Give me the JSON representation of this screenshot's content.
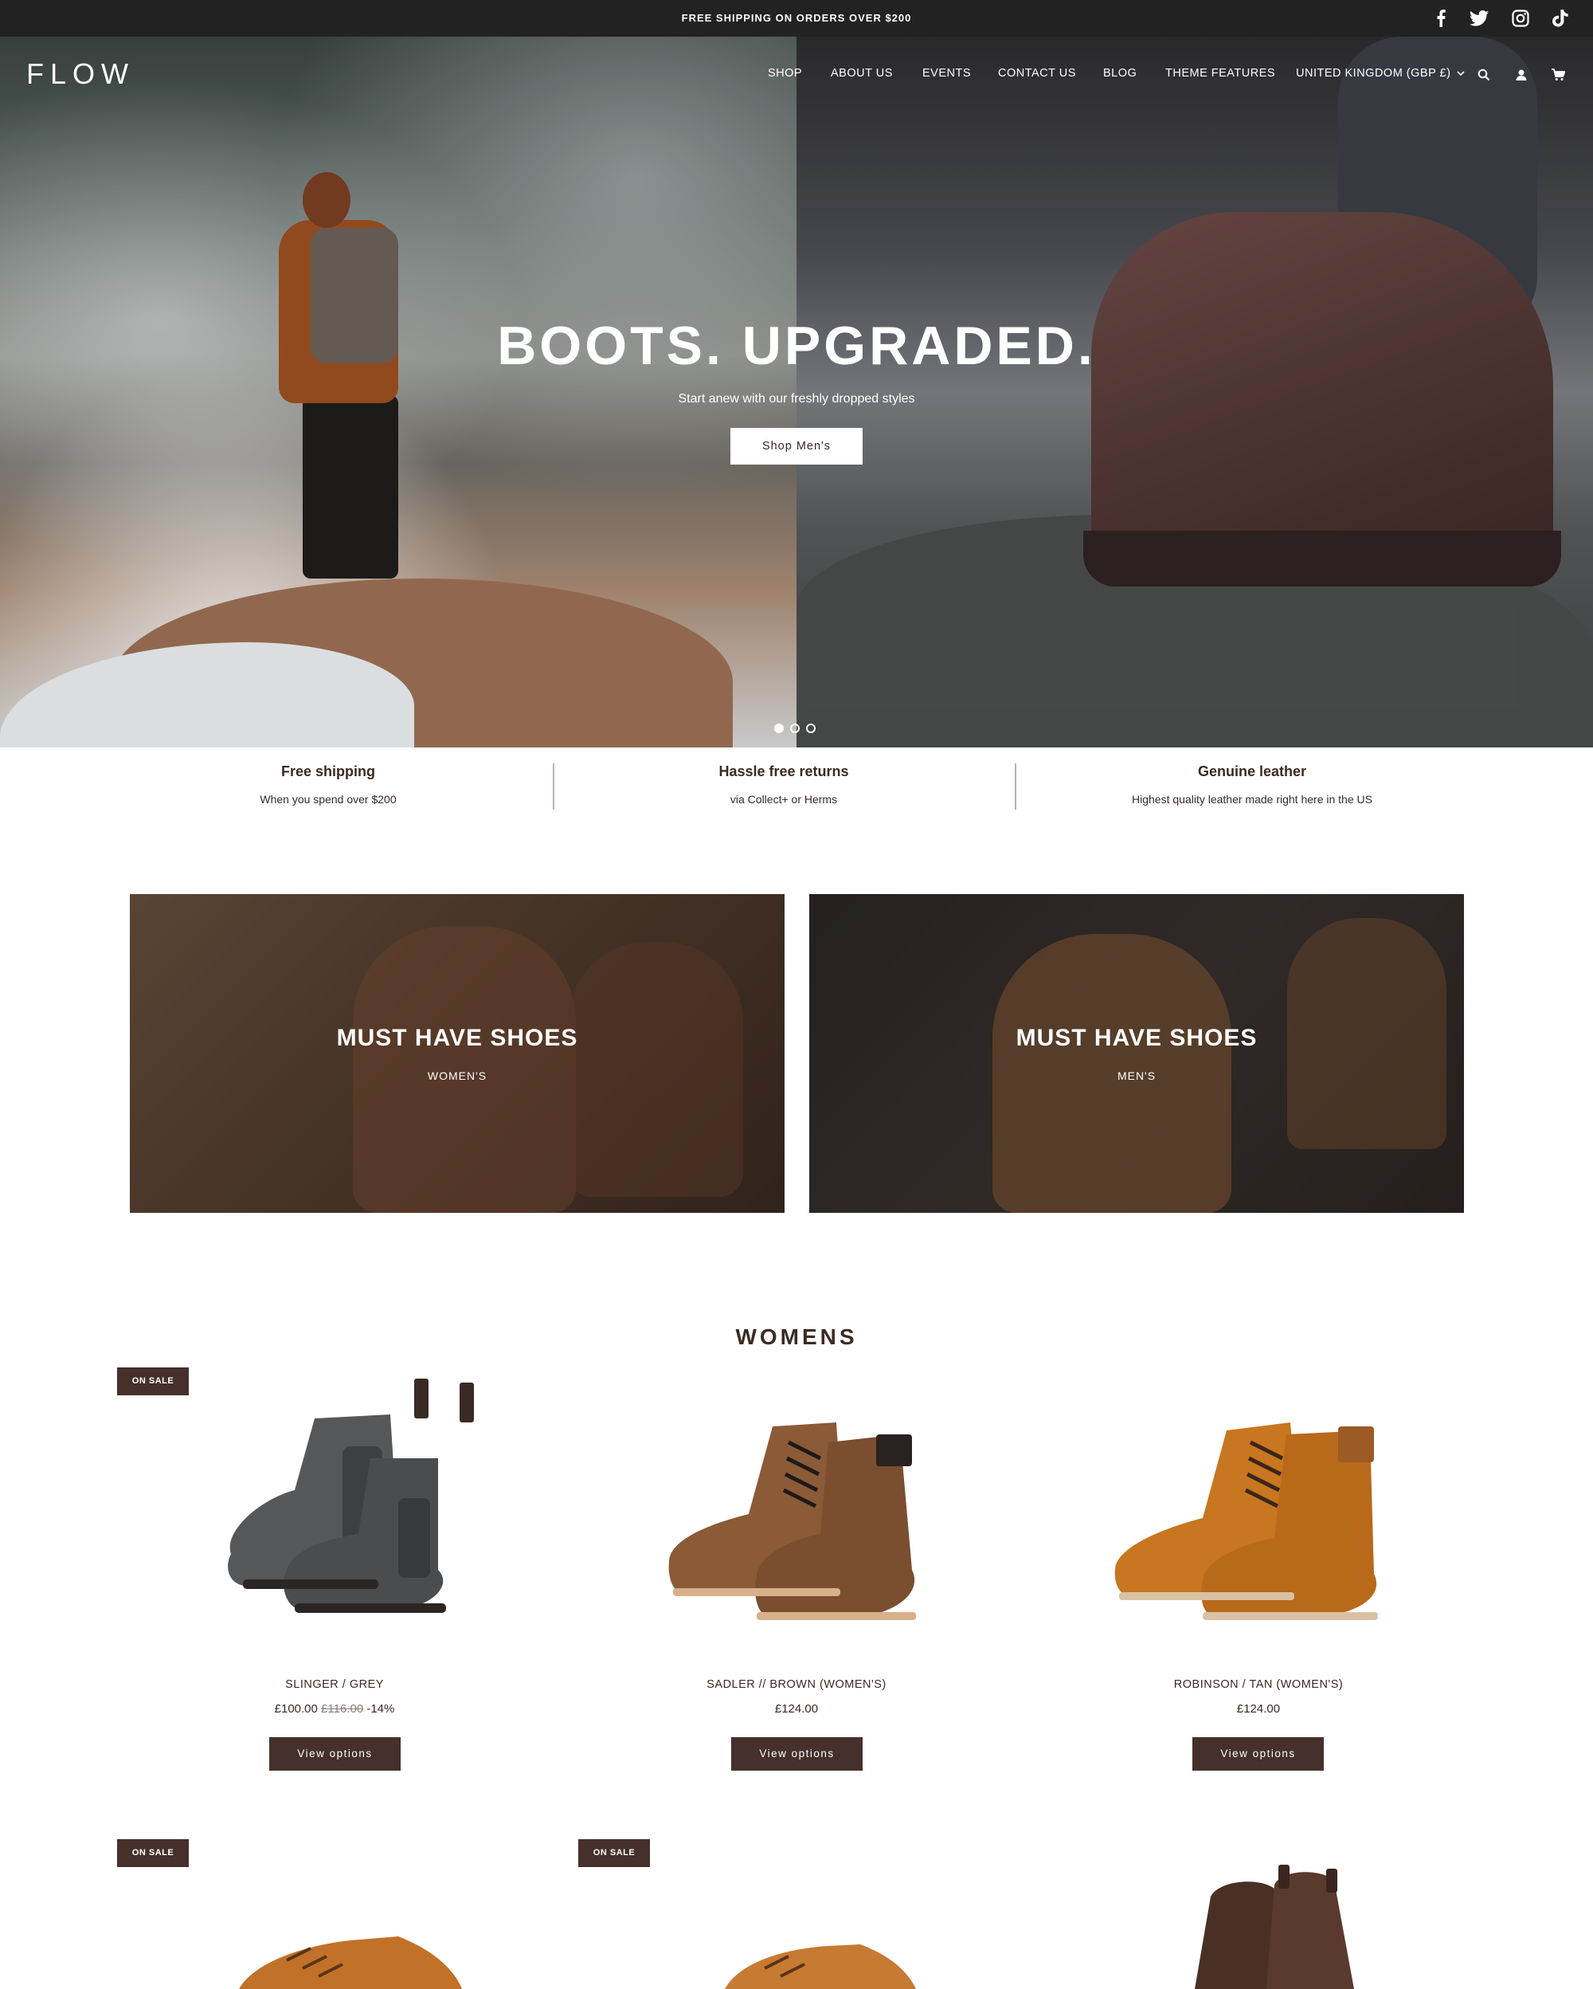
{
  "announcement": {
    "text": "FREE SHIPPING ON ORDERS OVER $200"
  },
  "social": [
    "facebook-icon",
    "twitter-icon",
    "instagram-icon",
    "tiktok-icon"
  ],
  "header": {
    "logo": "FLOW",
    "nav": [
      "SHOP",
      "ABOUT US",
      "EVENTS",
      "CONTACT US",
      "BLOG",
      "THEME FEATURES",
      "UNITED KINGDOM (GBP £)"
    ],
    "icons": [
      "search-icon",
      "account-icon",
      "cart-icon"
    ]
  },
  "hero": {
    "title": "BOOTS. UPGRADED.",
    "subtitle": "Start anew with our freshly dropped styles",
    "button": "Shop Men's",
    "slides": 3,
    "active_slide": 1
  },
  "features": [
    {
      "title": "Free shipping",
      "subtitle": "When you spend over $200"
    },
    {
      "title": "Hassle free returns",
      "subtitle": "via Collect+ or Herms"
    },
    {
      "title": "Genuine leather",
      "subtitle": "Highest quality leather made right here in the US"
    }
  ],
  "promos": [
    {
      "title": "MUST HAVE SHOES",
      "subtitle": "WOMEN'S"
    },
    {
      "title": "MUST HAVE SHOES",
      "subtitle": "MEN'S"
    }
  ],
  "womens": {
    "title": "WOMENS",
    "badge": "ON SALE",
    "button": "View options",
    "products": [
      {
        "name": "SLINGER / GREY",
        "price": "£100.00",
        "old_price": "£116.00",
        "discount": "-14%",
        "on_sale": true
      },
      {
        "name": "SADLER // BROWN (WOMEN'S)",
        "price": "£124.00",
        "on_sale": false
      },
      {
        "name": "ROBINSON / TAN (WOMEN'S)",
        "price": "£124.00",
        "on_sale": false
      }
    ],
    "second_row_badges": [
      "ON SALE",
      "ON SALE"
    ]
  }
}
